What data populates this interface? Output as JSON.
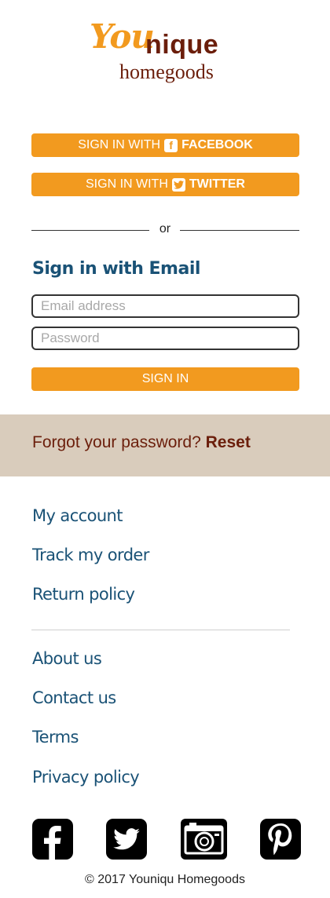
{
  "logo": {
    "part1": "You",
    "part2": "nique",
    "part3": "homegoods"
  },
  "social_signin": {
    "facebook": {
      "prefix": "SIGN IN WITH",
      "icon": "f",
      "label": "FACEBOOK"
    },
    "twitter": {
      "prefix": "SIGN IN WITH",
      "label": "TWITTER"
    }
  },
  "divider_text": "or",
  "email_section": {
    "title": "Sign in with Email",
    "email_placeholder": "Email address",
    "password_placeholder": "Password",
    "submit_label": "SIGN IN"
  },
  "forgot": {
    "text": "Forgot your password?",
    "reset_label": "Reset"
  },
  "footer": {
    "links_group1": [
      "My account",
      "Track my order",
      "Return policy"
    ],
    "links_group2": [
      "About us",
      "Contact us",
      "Terms",
      "Privacy policy"
    ],
    "social_icons": [
      "facebook-icon",
      "twitter-icon",
      "camera-icon",
      "pinterest-icon"
    ],
    "copyright": "© 2017 Youniqu Homegoods"
  },
  "colors": {
    "accent": "#f29a1f",
    "brand": "#6b1e0b",
    "link": "#1a5276",
    "band": "#d9ccbc"
  }
}
